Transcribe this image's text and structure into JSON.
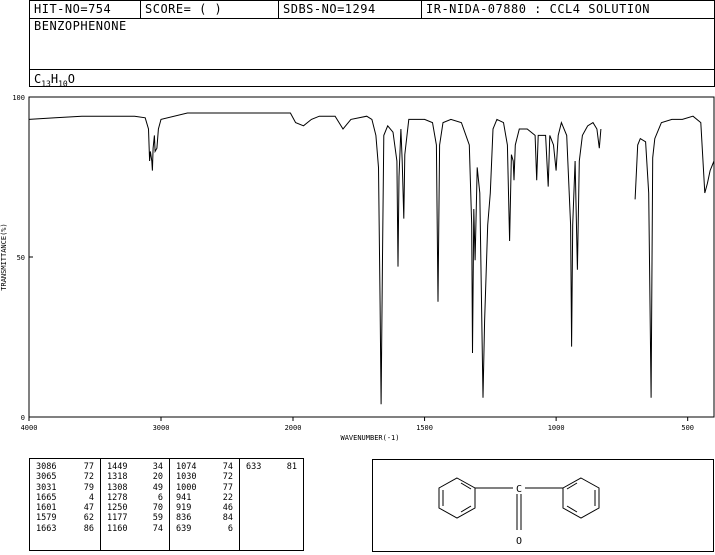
{
  "header": {
    "hit_no": "HIT-NO=754",
    "score": "SCORE=  (  )",
    "sdbs_no": "SDBS-NO=1294",
    "ir_info": "IR-NIDA-07880 : CCL4 SOLUTION",
    "compound_name": "BENZOPHENONE",
    "formula_parts": [
      "C",
      "13",
      "H",
      "10",
      "O"
    ]
  },
  "chart_data": {
    "type": "line",
    "title": "",
    "xlabel": "WAVENUMBER(-1)",
    "ylabel": "TRANSMITTANCE(%)",
    "xlim": [
      4000,
      400
    ],
    "ylim": [
      0,
      100
    ],
    "x_ticks": [
      "4000",
      "3000",
      "2000",
      "1500",
      "1000",
      "500"
    ],
    "x_tick_values": [
      4000,
      3000,
      2000,
      1500,
      1000,
      500
    ],
    "y_ticks": [
      "0",
      "50",
      "100"
    ],
    "y_tick_values": [
      0,
      50,
      100
    ],
    "series": [
      {
        "points": [
          [
            4000,
            93
          ],
          [
            3800,
            93.5
          ],
          [
            3600,
            94
          ],
          [
            3400,
            94
          ],
          [
            3200,
            94
          ],
          [
            3120,
            93.5
          ],
          [
            3095,
            90
          ],
          [
            3086,
            80
          ],
          [
            3080,
            83
          ],
          [
            3070,
            80
          ],
          [
            3065,
            77
          ],
          [
            3060,
            84
          ],
          [
            3050,
            88
          ],
          [
            3045,
            83
          ],
          [
            3031,
            84
          ],
          [
            3020,
            90
          ],
          [
            3000,
            93
          ],
          [
            2800,
            95
          ],
          [
            2500,
            95
          ],
          [
            2200,
            95
          ],
          [
            2020,
            95
          ],
          [
            1990,
            92
          ],
          [
            1960,
            91
          ],
          [
            1930,
            93
          ],
          [
            1900,
            94
          ],
          [
            1840,
            94
          ],
          [
            1810,
            90
          ],
          [
            1780,
            93
          ],
          [
            1720,
            94
          ],
          [
            1700,
            93
          ],
          [
            1685,
            88
          ],
          [
            1675,
            78
          ],
          [
            1669,
            35
          ],
          [
            1665,
            4
          ],
          [
            1660,
            50
          ],
          [
            1655,
            88
          ],
          [
            1640,
            91
          ],
          [
            1620,
            89
          ],
          [
            1605,
            80
          ],
          [
            1601,
            47
          ],
          [
            1597,
            75
          ],
          [
            1590,
            90
          ],
          [
            1585,
            80
          ],
          [
            1579,
            62
          ],
          [
            1575,
            82
          ],
          [
            1560,
            93
          ],
          [
            1500,
            93
          ],
          [
            1470,
            92
          ],
          [
            1455,
            85
          ],
          [
            1449,
            36
          ],
          [
            1443,
            85
          ],
          [
            1430,
            92
          ],
          [
            1400,
            93
          ],
          [
            1360,
            92
          ],
          [
            1330,
            85
          ],
          [
            1321,
            60
          ],
          [
            1318,
            20
          ],
          [
            1313,
            65
          ],
          [
            1308,
            49
          ],
          [
            1300,
            78
          ],
          [
            1290,
            70
          ],
          [
            1278,
            6
          ],
          [
            1272,
            30
          ],
          [
            1260,
            60
          ],
          [
            1250,
            70
          ],
          [
            1240,
            90
          ],
          [
            1225,
            93
          ],
          [
            1200,
            92
          ],
          [
            1185,
            85
          ],
          [
            1177,
            55
          ],
          [
            1170,
            82
          ],
          [
            1163,
            80
          ],
          [
            1160,
            74
          ],
          [
            1155,
            85
          ],
          [
            1140,
            90
          ],
          [
            1110,
            90
          ],
          [
            1080,
            88
          ],
          [
            1074,
            74
          ],
          [
            1068,
            88
          ],
          [
            1040,
            88
          ],
          [
            1030,
            72
          ],
          [
            1024,
            88
          ],
          [
            1010,
            85
          ],
          [
            1000,
            77
          ],
          [
            992,
            88
          ],
          [
            980,
            92
          ],
          [
            960,
            88
          ],
          [
            945,
            60
          ],
          [
            941,
            22
          ],
          [
            937,
            60
          ],
          [
            928,
            80
          ],
          [
            919,
            46
          ],
          [
            912,
            80
          ],
          [
            900,
            88
          ],
          [
            880,
            91
          ],
          [
            860,
            92
          ],
          [
            845,
            90
          ],
          [
            836,
            84
          ],
          [
            830,
            90
          ],
          [
            830,
            null
          ],
          [
            700,
            null
          ],
          [
            700,
            68
          ],
          [
            690,
            85
          ],
          [
            680,
            87
          ],
          [
            660,
            86
          ],
          [
            648,
            70
          ],
          [
            639,
            6
          ],
          [
            633,
            81
          ],
          [
            625,
            87
          ],
          [
            600,
            92
          ],
          [
            560,
            93
          ],
          [
            520,
            93
          ],
          [
            480,
            94
          ],
          [
            450,
            92
          ],
          [
            435,
            70
          ],
          [
            425,
            73
          ],
          [
            415,
            77
          ],
          [
            400,
            80
          ]
        ]
      }
    ],
    "peaks": [
      [
        3086,
        77
      ],
      [
        3065,
        72
      ],
      [
        3031,
        79
      ],
      [
        1665,
        4
      ],
      [
        1601,
        47
      ],
      [
        1579,
        62
      ],
      [
        1663,
        86
      ],
      [
        1449,
        34
      ],
      [
        1318,
        20
      ],
      [
        1308,
        49
      ],
      [
        1278,
        6
      ],
      [
        1250,
        70
      ],
      [
        1177,
        59
      ],
      [
        1160,
        74
      ],
      [
        1074,
        74
      ],
      [
        1030,
        72
      ],
      [
        1000,
        77
      ],
      [
        941,
        22
      ],
      [
        919,
        46
      ],
      [
        836,
        84
      ],
      [
        639,
        6
      ],
      [
        633,
        81
      ]
    ],
    "peak_table": [
      [
        [
          "3086",
          "77"
        ],
        [
          "3065",
          "72"
        ],
        [
          "3031",
          "79"
        ],
        [
          "1665",
          "4"
        ],
        [
          "1601",
          "47"
        ],
        [
          "1579",
          "62"
        ],
        [
          "1663",
          "86"
        ]
      ],
      [
        [
          "1449",
          "34"
        ],
        [
          "1318",
          "20"
        ],
        [
          "1308",
          "49"
        ],
        [
          "1278",
          "6"
        ],
        [
          "1250",
          "70"
        ],
        [
          "1177",
          "59"
        ],
        [
          "1160",
          "74"
        ]
      ],
      [
        [
          "1074",
          "74"
        ],
        [
          "1030",
          "72"
        ],
        [
          "1000",
          "77"
        ],
        [
          "941",
          "22"
        ],
        [
          "919",
          "46"
        ],
        [
          "836",
          "84"
        ],
        [
          "639",
          "6"
        ]
      ],
      [
        [
          "633",
          "81"
        ]
      ]
    ]
  },
  "structure": {
    "oxygen_label": "O",
    "carbon_label": "C"
  }
}
